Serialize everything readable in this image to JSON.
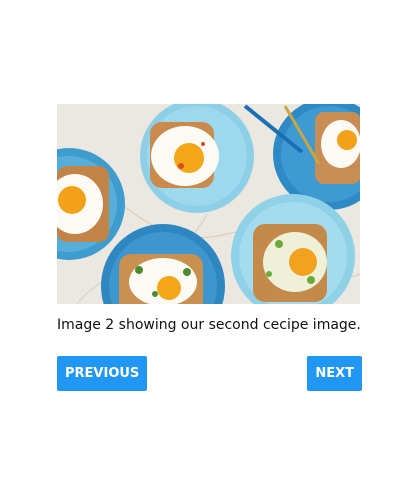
{
  "slide": {
    "image_alt": "Fried egg toasts on blue plates",
    "caption": "Image 2 showing our second cecipe image."
  },
  "controls": {
    "previous_label": "PREVIOUS",
    "next_label": "NEXT"
  },
  "colors": {
    "button": "#2196f3",
    "button_text": "#ffffff",
    "caption_text": "#111111"
  }
}
